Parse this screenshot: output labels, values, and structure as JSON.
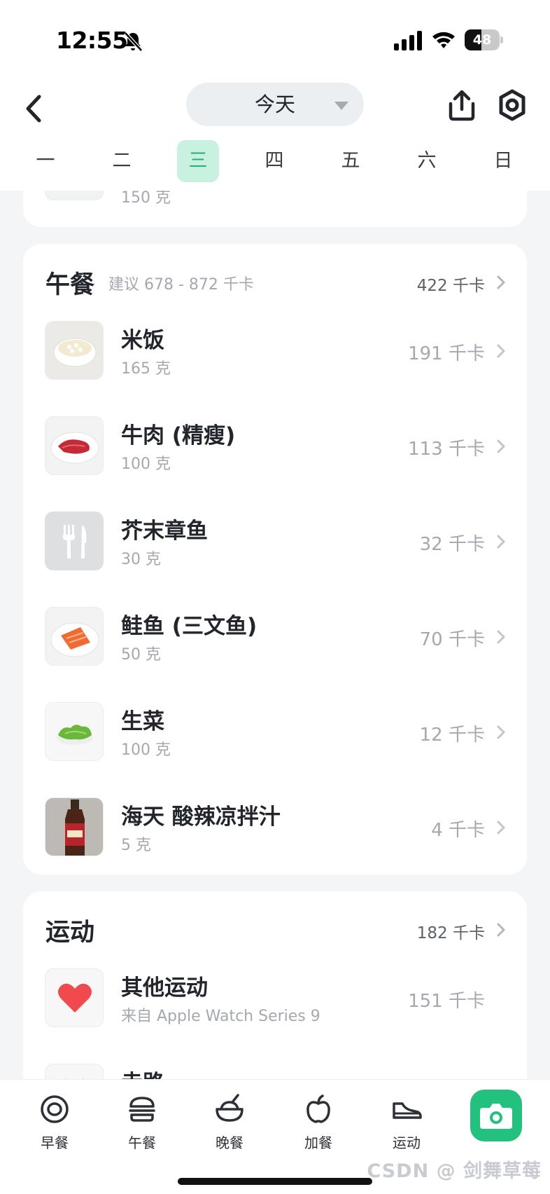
{
  "status_bar": {
    "time": "12:55",
    "battery": "48"
  },
  "nav": {
    "date_label": "今天"
  },
  "week": {
    "days": [
      "一",
      "二",
      "三",
      "四",
      "五",
      "六",
      "日"
    ],
    "active_index": 2
  },
  "breakfast_tail": {
    "amount": "150 克"
  },
  "lunch": {
    "title": "午餐",
    "hint": "建议 678 - 872 千卡",
    "total": "422 千卡",
    "items": [
      {
        "name": "米饭",
        "amount": "165 克",
        "kcal": "191 千卡",
        "icon": "rice-bowl"
      },
      {
        "name": "牛肉 (精瘦)",
        "amount": "100 克",
        "kcal": "113 千卡",
        "icon": "beef-plate"
      },
      {
        "name": "芥末章鱼",
        "amount": "30 克",
        "kcal": "32 千卡",
        "icon": "cutlery-placeholder"
      },
      {
        "name": "鲑鱼 (三文鱼)",
        "amount": "50 克",
        "kcal": "70 千卡",
        "icon": "salmon-plate"
      },
      {
        "name": "生菜",
        "amount": "100 克",
        "kcal": "12 千卡",
        "icon": "lettuce-plate"
      },
      {
        "name": "海天 酸辣凉拌汁",
        "amount": "5 克",
        "kcal": "4 千卡",
        "icon": "sauce-bottle"
      }
    ]
  },
  "exercise": {
    "title": "运动",
    "total": "182 千卡",
    "items": [
      {
        "name": "其他运动",
        "amount": "来自 Apple Watch Series 9",
        "kcal": "151 千卡",
        "icon": "heart-icon"
      },
      {
        "name": "走路",
        "amount": "",
        "kcal": "",
        "icon": "heart-icon"
      }
    ]
  },
  "tabs": [
    {
      "label": "早餐",
      "icon": "breakfast-icon"
    },
    {
      "label": "午餐",
      "icon": "burger-icon"
    },
    {
      "label": "晚餐",
      "icon": "bowl-icon"
    },
    {
      "label": "加餐",
      "icon": "apple-icon"
    },
    {
      "label": "运动",
      "icon": "sneaker-icon"
    }
  ],
  "watermark": "CSDN @ 剑舞草莓",
  "colors": {
    "accent": "#22c27e",
    "accent_light": "#c9f1df",
    "heart": "#f04a4f"
  }
}
